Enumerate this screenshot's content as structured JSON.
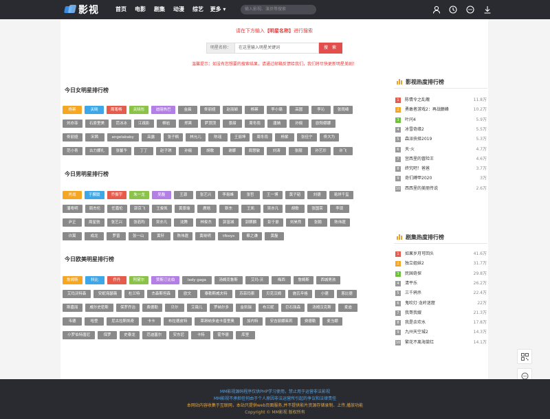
{
  "header": {
    "logo_text": "影视",
    "nav": [
      "首页",
      "电影",
      "剧集",
      "动漫",
      "综艺",
      "更多"
    ],
    "search_placeholder": "输入影视、演员等搜索",
    "icons": [
      "user-icon",
      "history-icon",
      "message-icon",
      "download-icon"
    ]
  },
  "search_panel": {
    "tip_prefix": "请在下方输入",
    "tip_highlight": "【明星名称】",
    "tip_suffix": "进行搜索",
    "label": "明星名称：",
    "input_value": "在这里输入明星关键词",
    "button": "搜 索",
    "warning": "温馨提示：如没有您想要的搜索结果，请通过邮箱反馈给我们，我们将尽快更新明星美剧！"
  },
  "sections": [
    {
      "title": "今日女明星排行榜",
      "rows": [
        [
          {
            "t": "杨幂",
            "c": "#f5a623"
          },
          {
            "t": "关晓",
            "c": "#3ea7e8"
          },
          {
            "t": "周笔畅",
            "c": "#e55b4c"
          },
          {
            "t": "关晓彤",
            "c": "#8bc34a"
          },
          {
            "t": "迪丽热巴",
            "c": "#b37fe5"
          },
          "金晨",
          "佟丽娅",
          "赵丽颖",
          "杨幂",
          "李小璐",
          "高圆",
          "李沁",
          "张雨绮"
        ],
        [
          "刘亦菲",
          "石原里美",
          "范冰冰",
          "江疏影",
          "柳岩",
          "郑爽",
          "萨顶顶",
          "景甜",
          "周冬雨",
          "唐嫣",
          "孙俪",
          "欧阳娜娜"
        ],
        [
          "佟丽娅",
          "宋茜",
          "angelababy",
          "高露",
          "张子枫",
          "林允儿",
          "陈瑶",
          "王丽坤",
          "周冬雨",
          "杨紫",
          "张佳宁",
          "佟大为"
        ],
        [
          "范小青",
          "古力娜扎",
          "张馨予",
          "丁丁",
          "赵子琪",
          "孙俪",
          "胡歌",
          "谢娜",
          "周慧敏",
          "刘涛",
          "张靓",
          "孙艺珍",
          "许飞"
        ]
      ]
    },
    {
      "title": "今日男明星排行榜",
      "rows": [
        [
          {
            "t": "肖战",
            "c": "#f5a623"
          },
          {
            "t": "于朦胧",
            "c": "#3ea7e8"
          },
          {
            "t": "乔振宇",
            "c": "#e55b4c"
          },
          {
            "t": "朱一龙",
            "c": "#8bc34a"
          },
          {
            "t": "吴磊",
            "c": "#b37fe5"
          },
          "王源",
          "张艺兴",
          "李易峰",
          "张哲",
          "王一博",
          "黄子韬",
          "刘德",
          "易烊千玺"
        ],
        [
          "潘粤明",
          "周杰伦",
          "任嘉伦",
          "郭京飞",
          "王俊凯",
          "黄景瑜",
          "鹿晗",
          "靳东",
          "王凯",
          "吴亦凡",
          "胡歌",
          "张国荣",
          "李现"
        ],
        [
          "尹正",
          "周星驰",
          "张艺兴",
          "张若昀",
          "吴亦凡",
          "沈腾",
          "林俊杰",
          "郭富城",
          "郭麒麟",
          "彭于晏",
          "刘昊然",
          "张翰",
          "陈伟霆"
        ],
        [
          "许嵩",
          "成龙",
          "罗晋",
          "张一山",
          "黄轩",
          "陈伟霆",
          "黄晓明",
          "tfboys",
          "蔡之谦",
          "黄磊"
        ]
      ]
    },
    {
      "title": "今日欧美明星排行榜",
      "rows": [
        [
          {
            "t": "詹姆斯",
            "c": "#f5a623"
          },
          {
            "t": "科比",
            "c": "#3ea7e8"
          },
          {
            "t": "乔丹",
            "c": "#e55b4c"
          },
          {
            "t": "阿黛尔",
            "c": "#8bc34a"
          },
          {
            "t": "贾斯汀比伯",
            "c": "#b37fe5"
          },
          "lady gaga",
          "汤姆克鲁斯",
          "艾玛·沃",
          "梅西",
          "詹姆斯",
          "西城男孩"
        ],
        [
          "艾玛沃特森",
          "安妮海瑟薇",
          "杜兰特",
          "杰森斯坦森",
          "欧文",
          "泰勒斯威夫特",
          "苏菲玛索",
          "贝克汉姆",
          "施瓦辛格",
          "小德",
          "恩比德"
        ],
        [
          "斯嘉丽",
          "威尔史密斯",
          "保罗乔治",
          "费德勒",
          "贝尔",
          "艾薇儿",
          "罗纳尔多",
          "金凯瑞",
          "布兰妮",
          "巨石强森",
          "汤姆汉克斯",
          "麦迪"
        ],
        [
          "韦德",
          "哈登",
          "尼古拉斯凯奇",
          "卡卡",
          "布拉德皮特",
          "莱昂纳多迪卡普里奥",
          "加内特",
          "安吉丽娜茱莉",
          "费德勒",
          "麦当娜"
        ],
        [
          "小罗伯特唐尼",
          "保罗",
          "史泰龙",
          "范迪塞尔",
          "安东尼",
          "卡特",
          "霍华德",
          "库里"
        ]
      ]
    }
  ],
  "rank_movies": {
    "title": "影视热度排行榜",
    "items": [
      {
        "name": "陈情令之乱魄",
        "val": "11.8万",
        "c": "#e55b4c"
      },
      {
        "name": "勇敢者游戏2：再战巅峰",
        "val": "10.2万",
        "c": "#f5a623"
      },
      {
        "name": "叶问4",
        "val": "5.9万",
        "c": "#6dbf3c"
      },
      {
        "name": "冰雪奇缘2",
        "val": "5.5万",
        "c": "#999999"
      },
      {
        "name": "森派抉择2019",
        "val": "5.3万",
        "c": "#999999"
      },
      {
        "name": "天·火",
        "val": "4.7万",
        "c": "#999999"
      },
      {
        "name": "宫西里的冒险王",
        "val": "4.6万",
        "c": "#999999"
      },
      {
        "name": "终究吧！爸爸",
        "val": "3.7万",
        "c": "#999999"
      },
      {
        "name": "奇们缚甲2020",
        "val": "3万",
        "c": "#999999"
      },
      {
        "name": "西西里的美丽传说",
        "val": "2.6万",
        "c": "#999999"
      }
    ]
  },
  "rank_series": {
    "title": "剧集热度排行榜",
    "items": [
      {
        "name": "如果岁月可回头",
        "val": "41.6万",
        "c": "#e55b4c"
      },
      {
        "name": "独立姐妹2",
        "val": "31.7万",
        "c": "#f5a623"
      },
      {
        "name": "民国奇探",
        "val": "29.8万",
        "c": "#6dbf3c"
      },
      {
        "name": "清平乐",
        "val": "26.2万",
        "c": "#999999"
      },
      {
        "name": "三千鸦杀",
        "val": "22.4万",
        "c": "#999999"
      },
      {
        "name": "鬼吹灯·龙岭迷窟",
        "val": "22万",
        "c": "#999999"
      },
      {
        "name": "我哥我嫂",
        "val": "21.3万",
        "c": "#999999"
      },
      {
        "name": "我是余欢水",
        "val": "17.8万",
        "c": "#999999"
      },
      {
        "name": "九州天空城2",
        "val": "14.3万",
        "c": "#999999"
      },
      {
        "name": "繁花不离海棠红",
        "val": "14.1万",
        "c": "#999999"
      }
    ]
  },
  "footer": {
    "line1": "MM影视源码程序仅供PHP学习使用，禁止用于运营非法影视",
    "line2": "MM影视不承担任何由于个人原因非法运营所引起的争议和法律责任",
    "line3": "本网站内容收集于互联网，本站只提供web页面服务,并不提供影片资源存储录制、上传,播放功能",
    "line4": "Copyright © MM影视 版权所有"
  },
  "colors": {
    "header_bg": "#2a2b31",
    "accent": "#e24e4e",
    "footer_link": "#4fa3e8"
  }
}
